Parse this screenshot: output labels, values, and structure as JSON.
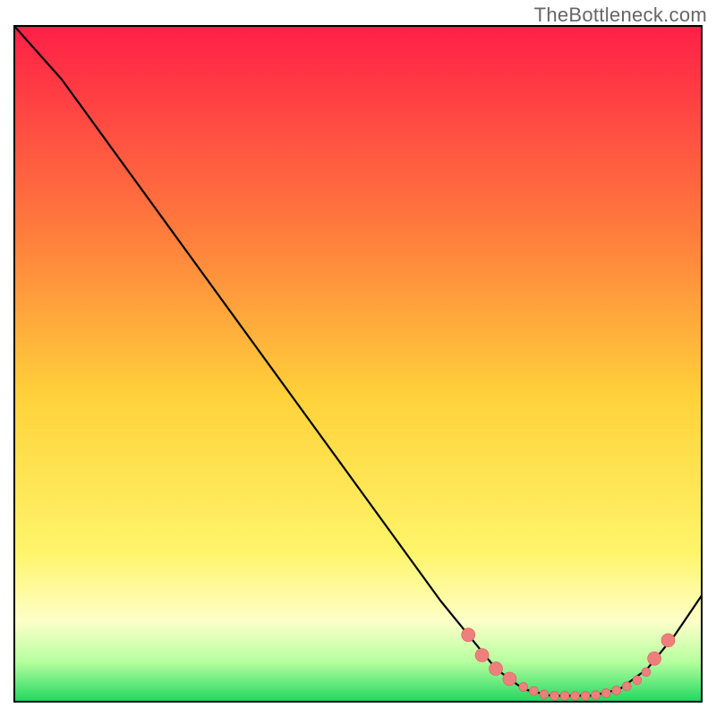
{
  "watermark": "TheBottleneck.com",
  "colors": {
    "gradient_top": "#ff1f47",
    "gradient_upper_mid": "#ff7a3d",
    "gradient_mid": "#ffd23a",
    "gradient_lower_mid": "#fff56b",
    "gradient_pale": "#fdffc9",
    "gradient_green_hi": "#b6ff9f",
    "gradient_green_lo": "#1dd65f",
    "curve": "#000000",
    "marker_fill": "#ef7f7d",
    "marker_stroke": "#d85b59",
    "border": "#000000"
  },
  "chart_data": {
    "type": "line",
    "title": "",
    "xlabel": "",
    "ylabel": "",
    "xlim": [
      0,
      100
    ],
    "ylim": [
      0,
      100
    ],
    "curve_points": [
      {
        "x": 0,
        "y": 100
      },
      {
        "x": 7,
        "y": 92
      },
      {
        "x": 62,
        "y": 15
      },
      {
        "x": 70,
        "y": 5
      },
      {
        "x": 74,
        "y": 2
      },
      {
        "x": 78,
        "y": 1
      },
      {
        "x": 84,
        "y": 1
      },
      {
        "x": 88,
        "y": 2
      },
      {
        "x": 92,
        "y": 5
      },
      {
        "x": 96,
        "y": 10
      },
      {
        "x": 100,
        "y": 16
      }
    ],
    "markers_large": [
      {
        "x": 66,
        "y": 10
      },
      {
        "x": 68,
        "y": 7
      },
      {
        "x": 70,
        "y": 5
      },
      {
        "x": 72,
        "y": 3.5
      },
      {
        "x": 93,
        "y": 6.5
      },
      {
        "x": 95,
        "y": 9.2
      }
    ],
    "markers_small": [
      {
        "x": 74,
        "y": 2.3
      },
      {
        "x": 75.5,
        "y": 1.7
      },
      {
        "x": 77,
        "y": 1.2
      },
      {
        "x": 78.5,
        "y": 1.0
      },
      {
        "x": 80,
        "y": 1.0
      },
      {
        "x": 81.5,
        "y": 1.0
      },
      {
        "x": 83,
        "y": 1.0
      },
      {
        "x": 84.5,
        "y": 1.1
      },
      {
        "x": 86,
        "y": 1.4
      },
      {
        "x": 87.5,
        "y": 1.8
      },
      {
        "x": 89,
        "y": 2.4
      },
      {
        "x": 90.5,
        "y": 3.3
      },
      {
        "x": 91.8,
        "y": 4.5
      }
    ]
  }
}
